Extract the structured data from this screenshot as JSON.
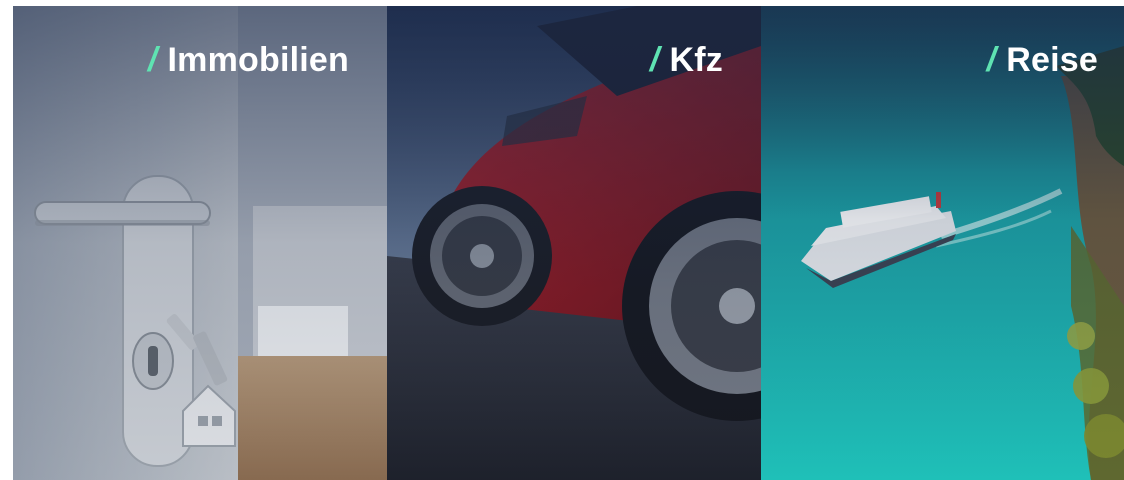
{
  "panels": [
    {
      "slash": "/",
      "label": "Immobilien"
    },
    {
      "slash": "/",
      "label": "Kfz"
    },
    {
      "slash": "/",
      "label": "Reise"
    }
  ],
  "colors": {
    "accent": "#5fe3b2",
    "overlay": "#1b2a4a",
    "water": "#1fb8b4"
  },
  "icons": [
    "door-key-image",
    "red-car-image",
    "ship-lake-image"
  ]
}
